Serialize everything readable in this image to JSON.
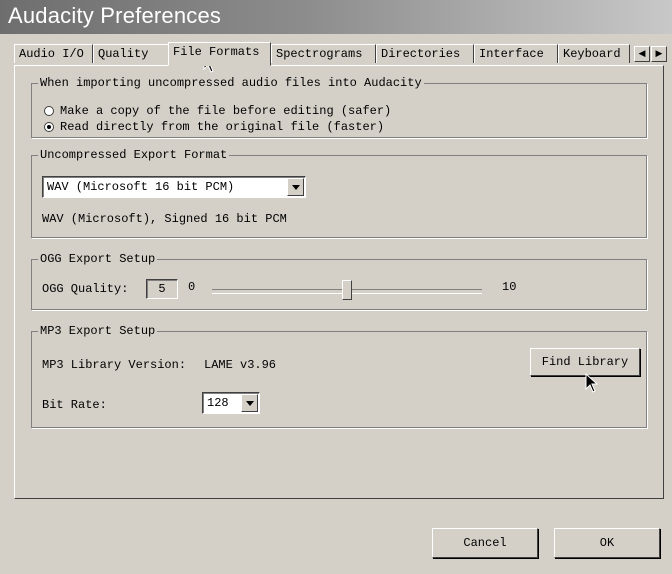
{
  "window": {
    "title": "Audacity Preferences"
  },
  "tabs": [
    {
      "label": "Audio I/O"
    },
    {
      "label": "Quality"
    },
    {
      "label": "File Formats"
    },
    {
      "label": "Spectrograms"
    },
    {
      "label": "Directories"
    },
    {
      "label": "Interface"
    },
    {
      "label": "Keyboard"
    }
  ],
  "active_tab": "File Formats",
  "import_group": {
    "legend": "When importing uncompressed audio files into Audacity",
    "options": [
      {
        "label": "Make a copy of the file before editing (safer)",
        "checked": false
      },
      {
        "label": "Read directly from the original file (faster)",
        "checked": true
      }
    ]
  },
  "export_format_group": {
    "legend": "Uncompressed Export Format",
    "selected": "WAV (Microsoft 16 bit PCM)",
    "description": "WAV (Microsoft), Signed 16 bit PCM"
  },
  "ogg_group": {
    "legend": "OGG Export Setup",
    "quality_label": "OGG Quality:",
    "quality_value": "5",
    "slider_min": "0",
    "slider_max": "10",
    "slider_value": 5
  },
  "mp3_group": {
    "legend": "MP3 Export Setup",
    "library_label": "MP3 Library Version:",
    "library_version": "LAME v3.96",
    "find_library_label": "Find Library",
    "bitrate_label": "Bit Rate:",
    "bitrate_value": "128"
  },
  "footer": {
    "cancel_label": "Cancel",
    "ok_label": "OK"
  },
  "icons": {
    "tab_scroll_left": "arrow-left-icon",
    "tab_scroll_right": "arrow-right-icon",
    "cursor": "mouse-pointer-icon"
  }
}
